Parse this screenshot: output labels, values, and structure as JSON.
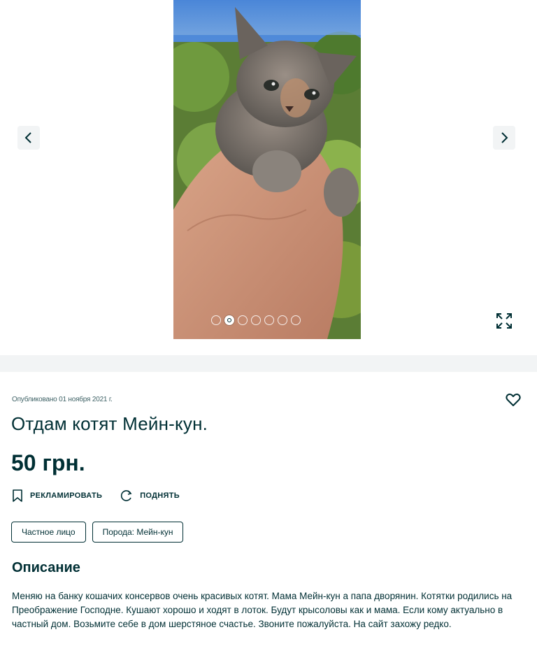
{
  "gallery": {
    "photo_count": 7,
    "active_index": 1,
    "prev_icon": "chevron-left-icon",
    "next_icon": "chevron-right-icon",
    "expand_icon": "expand-icon"
  },
  "listing": {
    "published": "Опубликовано 01 ноября 2021 г.",
    "title": "Отдам котят Мейн-кун.",
    "price": "50 грн.",
    "favorite_icon": "heart-icon"
  },
  "actions": {
    "promote_label": "РЕКЛАМИРОВАТЬ",
    "raise_label": "ПОДНЯТЬ"
  },
  "tags": [
    "Частное лицо",
    "Порода: Мейн-кун"
  ],
  "description": {
    "heading": "Описание",
    "text": "Меняю на банку кошачих консервов очень красивых котят. Мама Мейн-кун а папа дворянин. Котятки родились на Преображение Господне. Кушают хорошо и ходят в лоток. Будут крысоловы как и мама. Если кому актуально в частный дом. Возьмите себе в дом шерстяное счастье. Звоните пожалуйста. На сайт захожу редко."
  },
  "colors": {
    "text": "#002f34",
    "separator": "#f2f4f5"
  }
}
